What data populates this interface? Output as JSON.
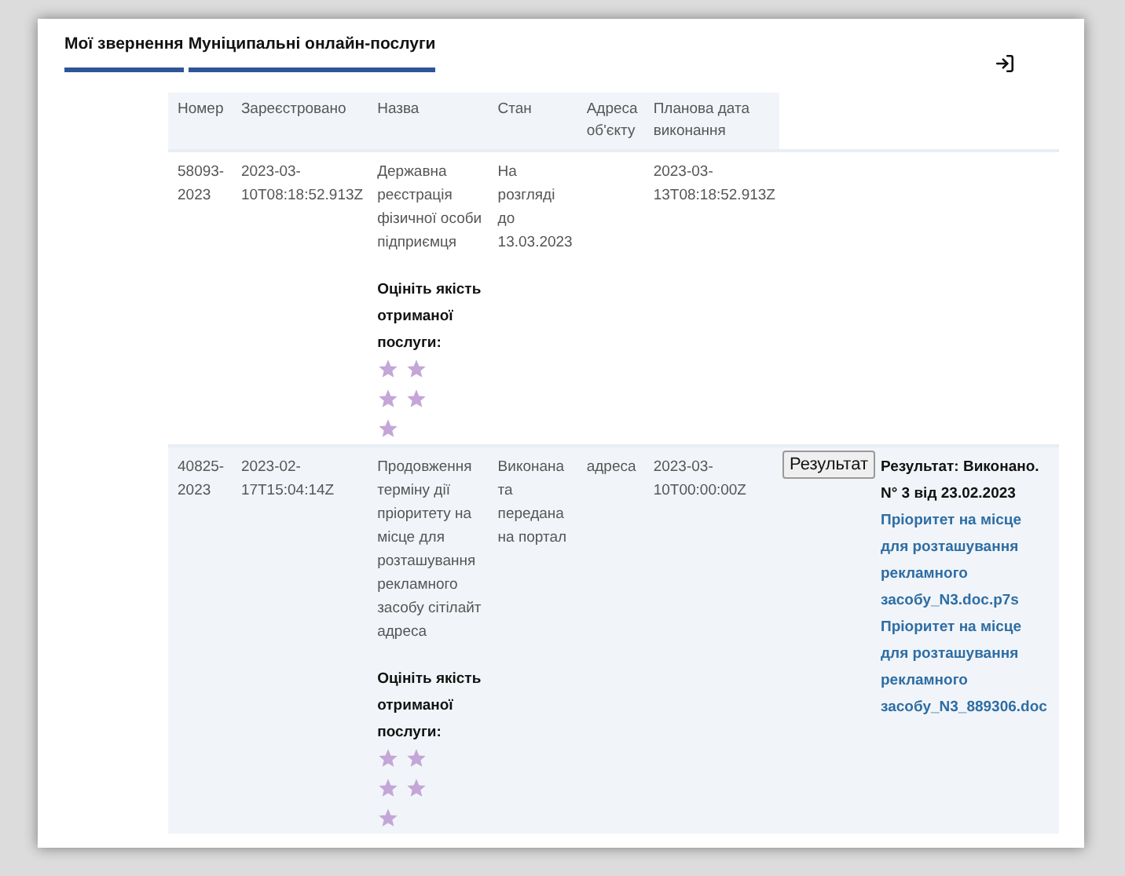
{
  "tabs": [
    {
      "label": "Мої звернення",
      "selected": true
    },
    {
      "label": "Муніципальні онлайн-послуги",
      "selected": true
    }
  ],
  "table": {
    "columns": [
      "Номер",
      "Зареєстровано",
      "Назва",
      "Стан",
      "Адреса об'єкту",
      "Планова дата виконання"
    ],
    "rows": [
      {
        "number": "58093-2023",
        "registered": "2023-03-10T08:18:52.913Z",
        "name": "Державна реєстрація фізичної особи підприємця",
        "status": "На розгляді до 13.03.2023",
        "planned_date": "2023-03-13T08:18:52.913Z",
        "rating": {
          "label": "Оцініть якість отриманої послуги:"
        }
      },
      {
        "number": "40825-2023",
        "registered": "2023-02-17T15:04:14Z",
        "name": "Продовження терміну дії пріоритету на місце для розташування рекламного засобу сітілайт адреса",
        "status": "Виконана та передана на портал",
        "address": "адреса",
        "planned_date": "2023-03-10T00:00:00Z",
        "rating": {
          "label": "Оцініть якість отриманої послуги:"
        },
        "result_button": "Результат",
        "result": {
          "title": "Результат: Виконано. N° 3 від 23.02.2023",
          "links": [
            "Пріоритет на місце для розташування рекламного засобу_N3.doc.p7s",
            "Пріоритет на місце для розташування рекламного засобу_N3_889306.doc"
          ]
        }
      }
    ]
  }
}
